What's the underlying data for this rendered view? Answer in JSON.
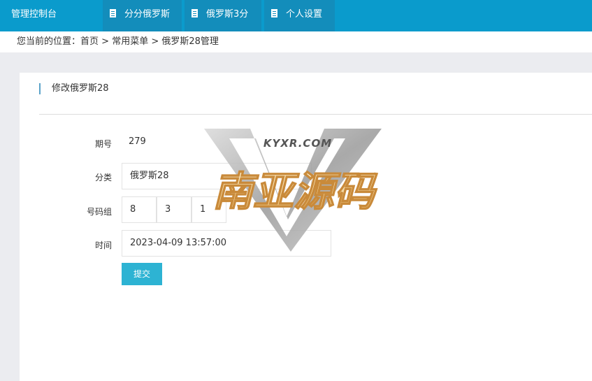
{
  "topbar": {
    "brand": "管理控制台",
    "nav": [
      {
        "label": "分分俄罗斯",
        "icon": "document-icon"
      },
      {
        "label": "俄罗斯3分",
        "icon": "document-icon"
      },
      {
        "label": "个人设置",
        "icon": "document-icon"
      }
    ]
  },
  "breadcrumb": {
    "prefix": "您当前的位置：",
    "items": [
      "首页",
      "常用菜单",
      "俄罗斯28管理"
    ],
    "separator": " > "
  },
  "form": {
    "section_title": "修改俄罗斯28",
    "period": {
      "label": "期号",
      "value": "279"
    },
    "category": {
      "label": "分类",
      "value": "俄罗斯28"
    },
    "numbers": {
      "label": "号码组",
      "values": [
        "8",
        "3",
        "1"
      ]
    },
    "time": {
      "label": "时间",
      "value": "2023-04-09 13:57:00"
    },
    "submit_label": "提交"
  },
  "watermark": {
    "top_text": "KYXR.COM",
    "main_text": "南亚源码"
  },
  "colors": {
    "topbar": "#0a9bcc",
    "nav_item": "#138dbb",
    "submit": "#2db3d3",
    "accent_line": "#5ba3c9"
  }
}
